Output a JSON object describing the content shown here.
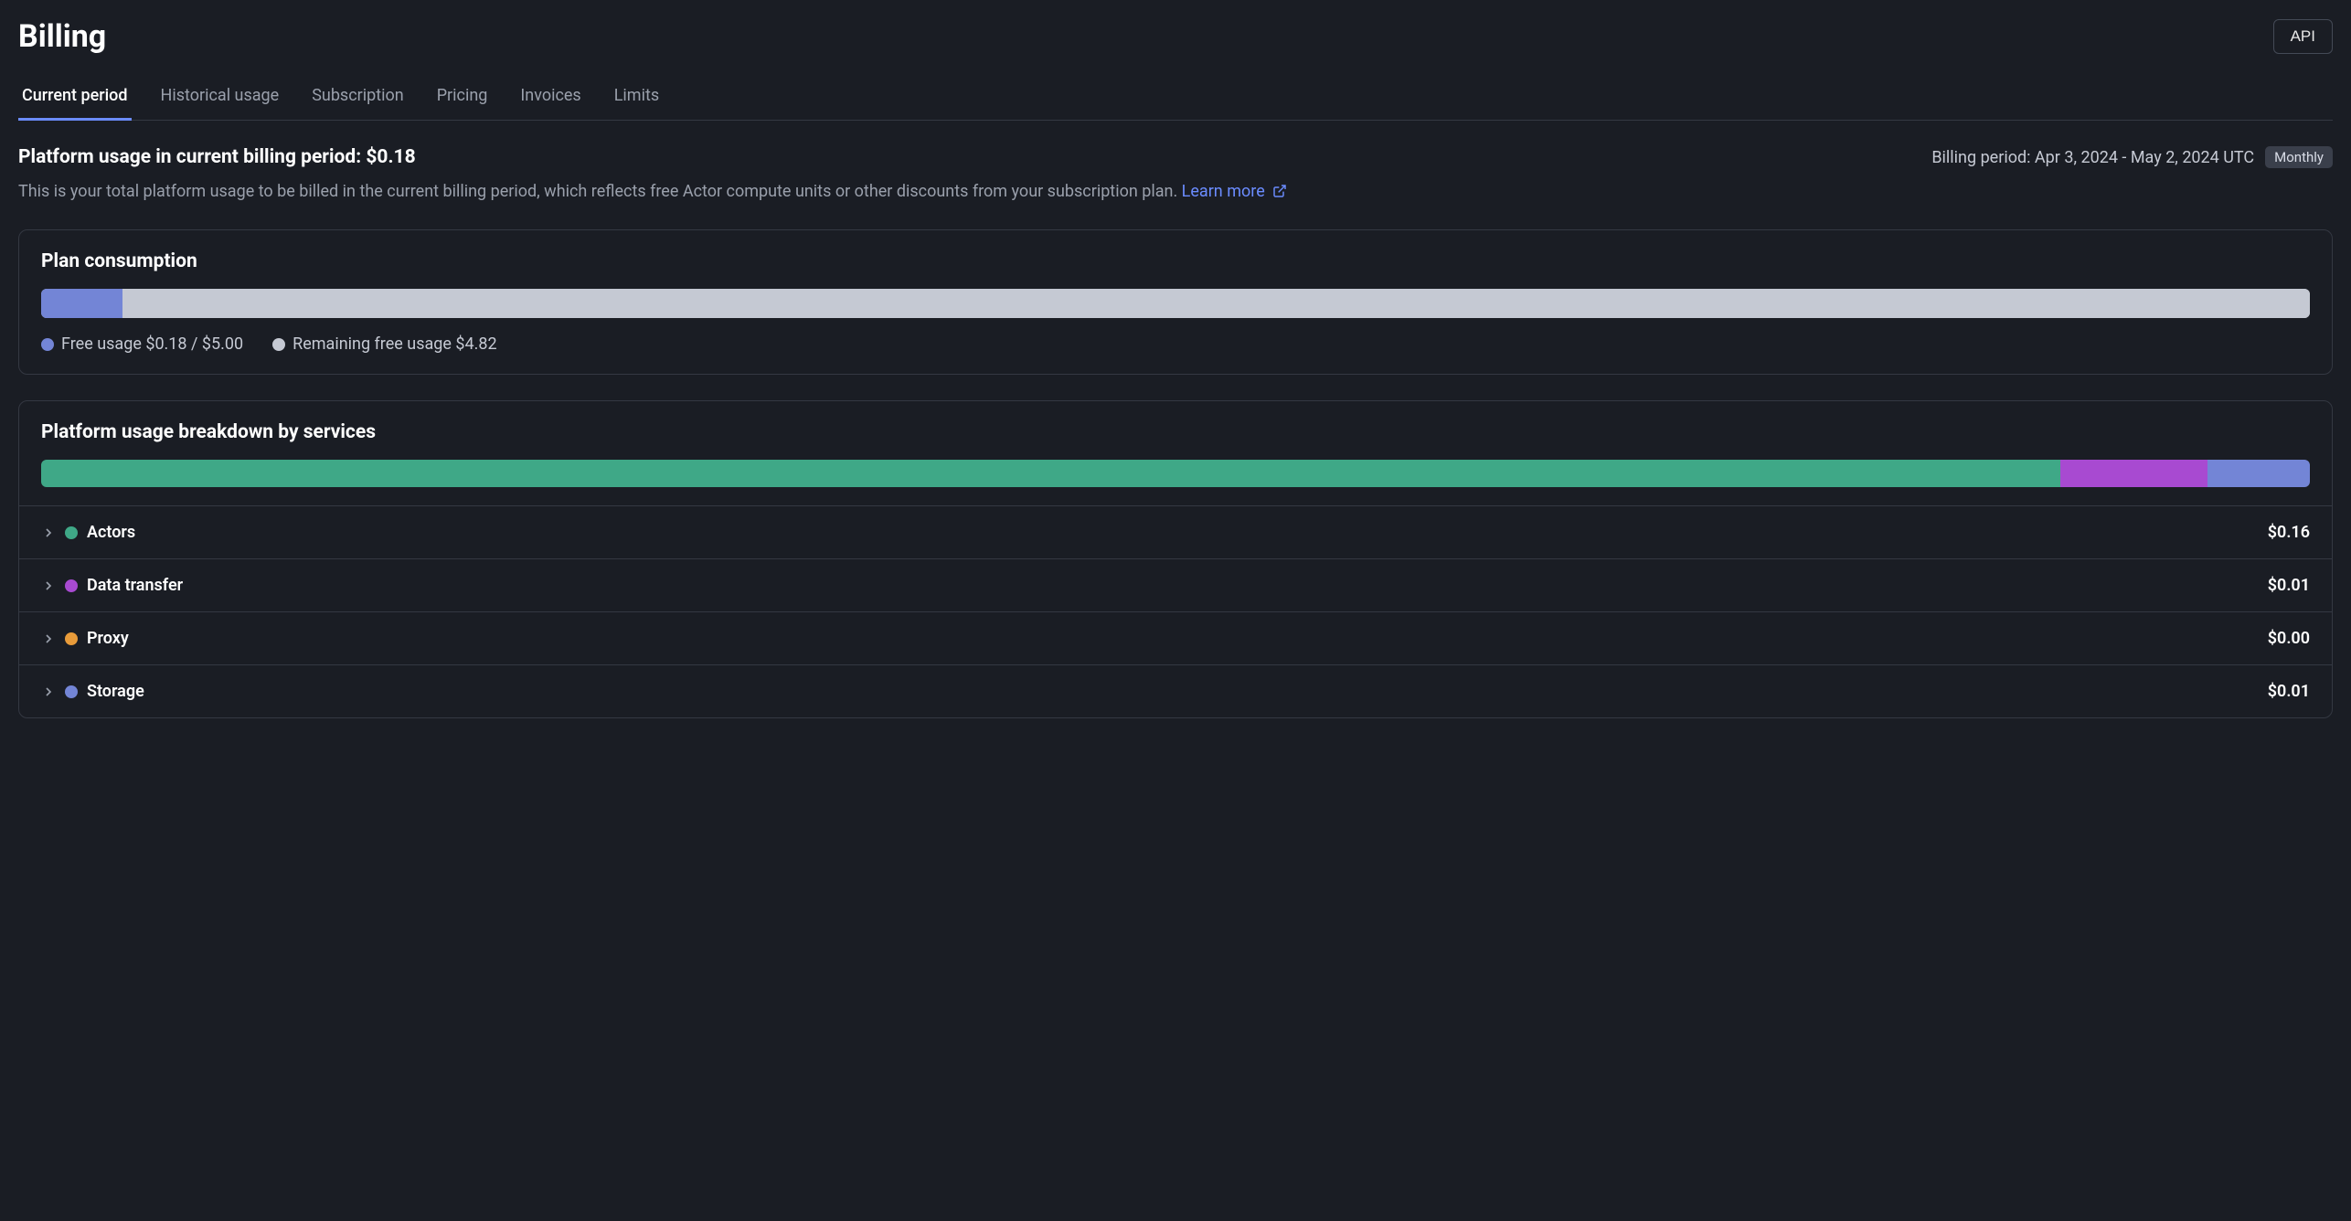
{
  "header": {
    "title": "Billing",
    "api_button": "API"
  },
  "tabs": [
    {
      "label": "Current period",
      "active": true
    },
    {
      "label": "Historical usage",
      "active": false
    },
    {
      "label": "Subscription",
      "active": false
    },
    {
      "label": "Pricing",
      "active": false
    },
    {
      "label": "Invoices",
      "active": false
    },
    {
      "label": "Limits",
      "active": false
    }
  ],
  "summary": {
    "title": "Platform usage in current billing period: $0.18",
    "period_label": "Billing period: Apr 3, 2024 - May 2, 2024 UTC",
    "badge": "Monthly",
    "description": "This is your total platform usage to be billed in the current billing period, which reflects free Actor compute units or other discounts from your subscription plan. ",
    "learn_more": "Learn more"
  },
  "plan_card": {
    "title": "Plan consumption",
    "used_color": "#7385d6",
    "remaining_color": "#c5c9d3",
    "used_pct": 3.6,
    "legend_used_label": "Free usage $0.18 / $5.00",
    "legend_remaining_label": "Remaining free usage $4.82"
  },
  "breakdown_card": {
    "title": "Platform usage breakdown by services",
    "segments": [
      {
        "name": "Actors",
        "color": "#3fa887",
        "pct": 89
      },
      {
        "name": "Data transfer",
        "color": "#a84ad1",
        "pct": 6.5
      },
      {
        "name": "Storage",
        "color": "#7385d6",
        "pct": 4.5
      }
    ],
    "rows": [
      {
        "name": "Actors",
        "color": "#3fa887",
        "value": "$0.16"
      },
      {
        "name": "Data transfer",
        "color": "#a84ad1",
        "value": "$0.01"
      },
      {
        "name": "Proxy",
        "color": "#e89b3a",
        "value": "$0.00"
      },
      {
        "name": "Storage",
        "color": "#7385d6",
        "value": "$0.01"
      }
    ]
  },
  "chart_data": {
    "type": "bar",
    "title": "Plan consumption",
    "categories": [
      "Free usage",
      "Remaining free usage"
    ],
    "values": [
      0.18,
      4.82
    ],
    "total": 5.0,
    "unit": "USD",
    "breakdown": {
      "type": "bar",
      "title": "Platform usage breakdown by services",
      "categories": [
        "Actors",
        "Data transfer",
        "Proxy",
        "Storage"
      ],
      "values": [
        0.16,
        0.01,
        0.0,
        0.01
      ],
      "total": 0.18,
      "unit": "USD"
    }
  }
}
